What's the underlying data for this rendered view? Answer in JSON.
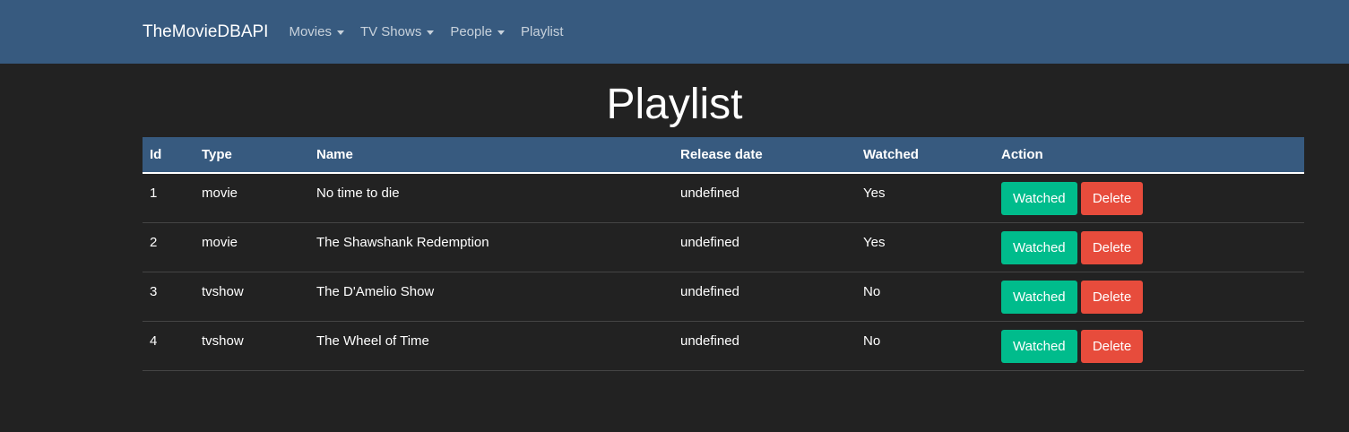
{
  "navbar": {
    "brand": "TheMovieDBAPI",
    "items": [
      {
        "label": "Movies",
        "dropdown": true
      },
      {
        "label": "TV Shows",
        "dropdown": true
      },
      {
        "label": "People",
        "dropdown": true
      },
      {
        "label": "Playlist",
        "dropdown": false
      }
    ]
  },
  "page": {
    "title": "Playlist"
  },
  "table": {
    "headers": [
      "Id",
      "Type",
      "Name",
      "Release date",
      "Watched",
      "Action"
    ],
    "rows": [
      {
        "id": "1",
        "type": "movie",
        "name": "No time to die",
        "release_date": "undefined",
        "watched": "Yes"
      },
      {
        "id": "2",
        "type": "movie",
        "name": "The Shawshank Redemption",
        "release_date": "undefined",
        "watched": "Yes"
      },
      {
        "id": "3",
        "type": "tvshow",
        "name": "The D'Amelio Show",
        "release_date": "undefined",
        "watched": "No"
      },
      {
        "id": "4",
        "type": "tvshow",
        "name": "The Wheel of Time",
        "release_date": "undefined",
        "watched": "No"
      }
    ],
    "watched_button_label": "Watched",
    "delete_button_label": "Delete"
  },
  "colors": {
    "navbar_bg": "#375a7f",
    "page_bg": "#222222",
    "watched_button": "#00bc8c",
    "delete_button": "#e74c3c"
  }
}
